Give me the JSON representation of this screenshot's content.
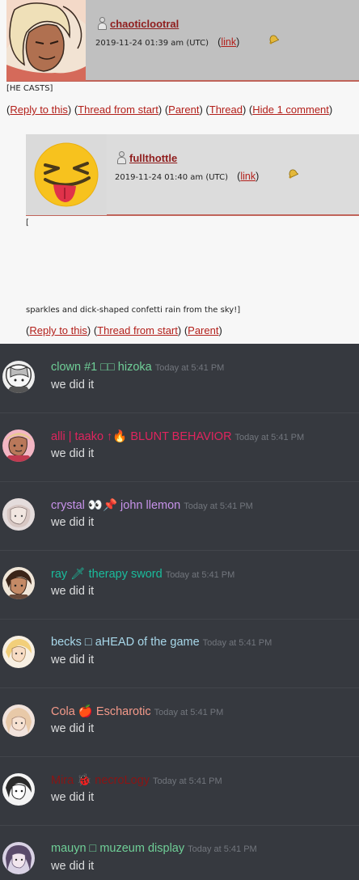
{
  "comments": [
    {
      "username": "chaoticlootral",
      "timestamp": "2019-11-24 01:39 am (UTC)",
      "link_label": "link",
      "body": "[HE CASTS]",
      "actions": [
        "Reply to this",
        "Thread from start",
        "Parent",
        "Thread",
        "Hide 1 comment"
      ]
    },
    {
      "username": "fullthottle",
      "timestamp": "2019-11-24 01:40 am (UTC)",
      "link_label": "link",
      "body_open": "[",
      "body_close": "sparkles and dick-shaped confetti rain from the sky!]",
      "actions": [
        "Reply to this",
        "Thread from start",
        "Parent"
      ]
    }
  ],
  "chat": {
    "messages": [
      {
        "author": "clown #1 □□ hizoka",
        "author_color": "#6fcf97",
        "time": "Today at 5:41 PM",
        "text": "we did it"
      },
      {
        "author": "alli | taako ↑🔥 BLUNT BEHAVIOR",
        "author_color": "#e0245e",
        "time": "Today at 5:41 PM",
        "text": "we did it"
      },
      {
        "author": "crystal 👀📌 john llemon",
        "author_color": "#c792ea",
        "time": "Today at 5:41 PM",
        "text": "we did it"
      },
      {
        "author": "ray 🗡 therapy sword",
        "author_color": "#1abc9c",
        "time": "Today at 5:41 PM",
        "text": "we did it"
      },
      {
        "author": "becks □ aHEAD of the game",
        "author_color": "#a8d8ea",
        "time": "Today at 5:41 PM",
        "text": "we did it"
      },
      {
        "author": "Cola 🍎 Escharotic",
        "author_color": "#f49a8a",
        "time": "Today at 5:41 PM",
        "text": "we did it"
      },
      {
        "author": "Mira 🐞 necroLogy",
        "author_color": "#8b1414",
        "time": "Today at 5:41 PM",
        "text": "we did it"
      },
      {
        "author": "mauyn □ muzeum display",
        "author_color": "#6fcf97",
        "time": "Today at 5:41 PM",
        "text": "we did it"
      }
    ]
  }
}
